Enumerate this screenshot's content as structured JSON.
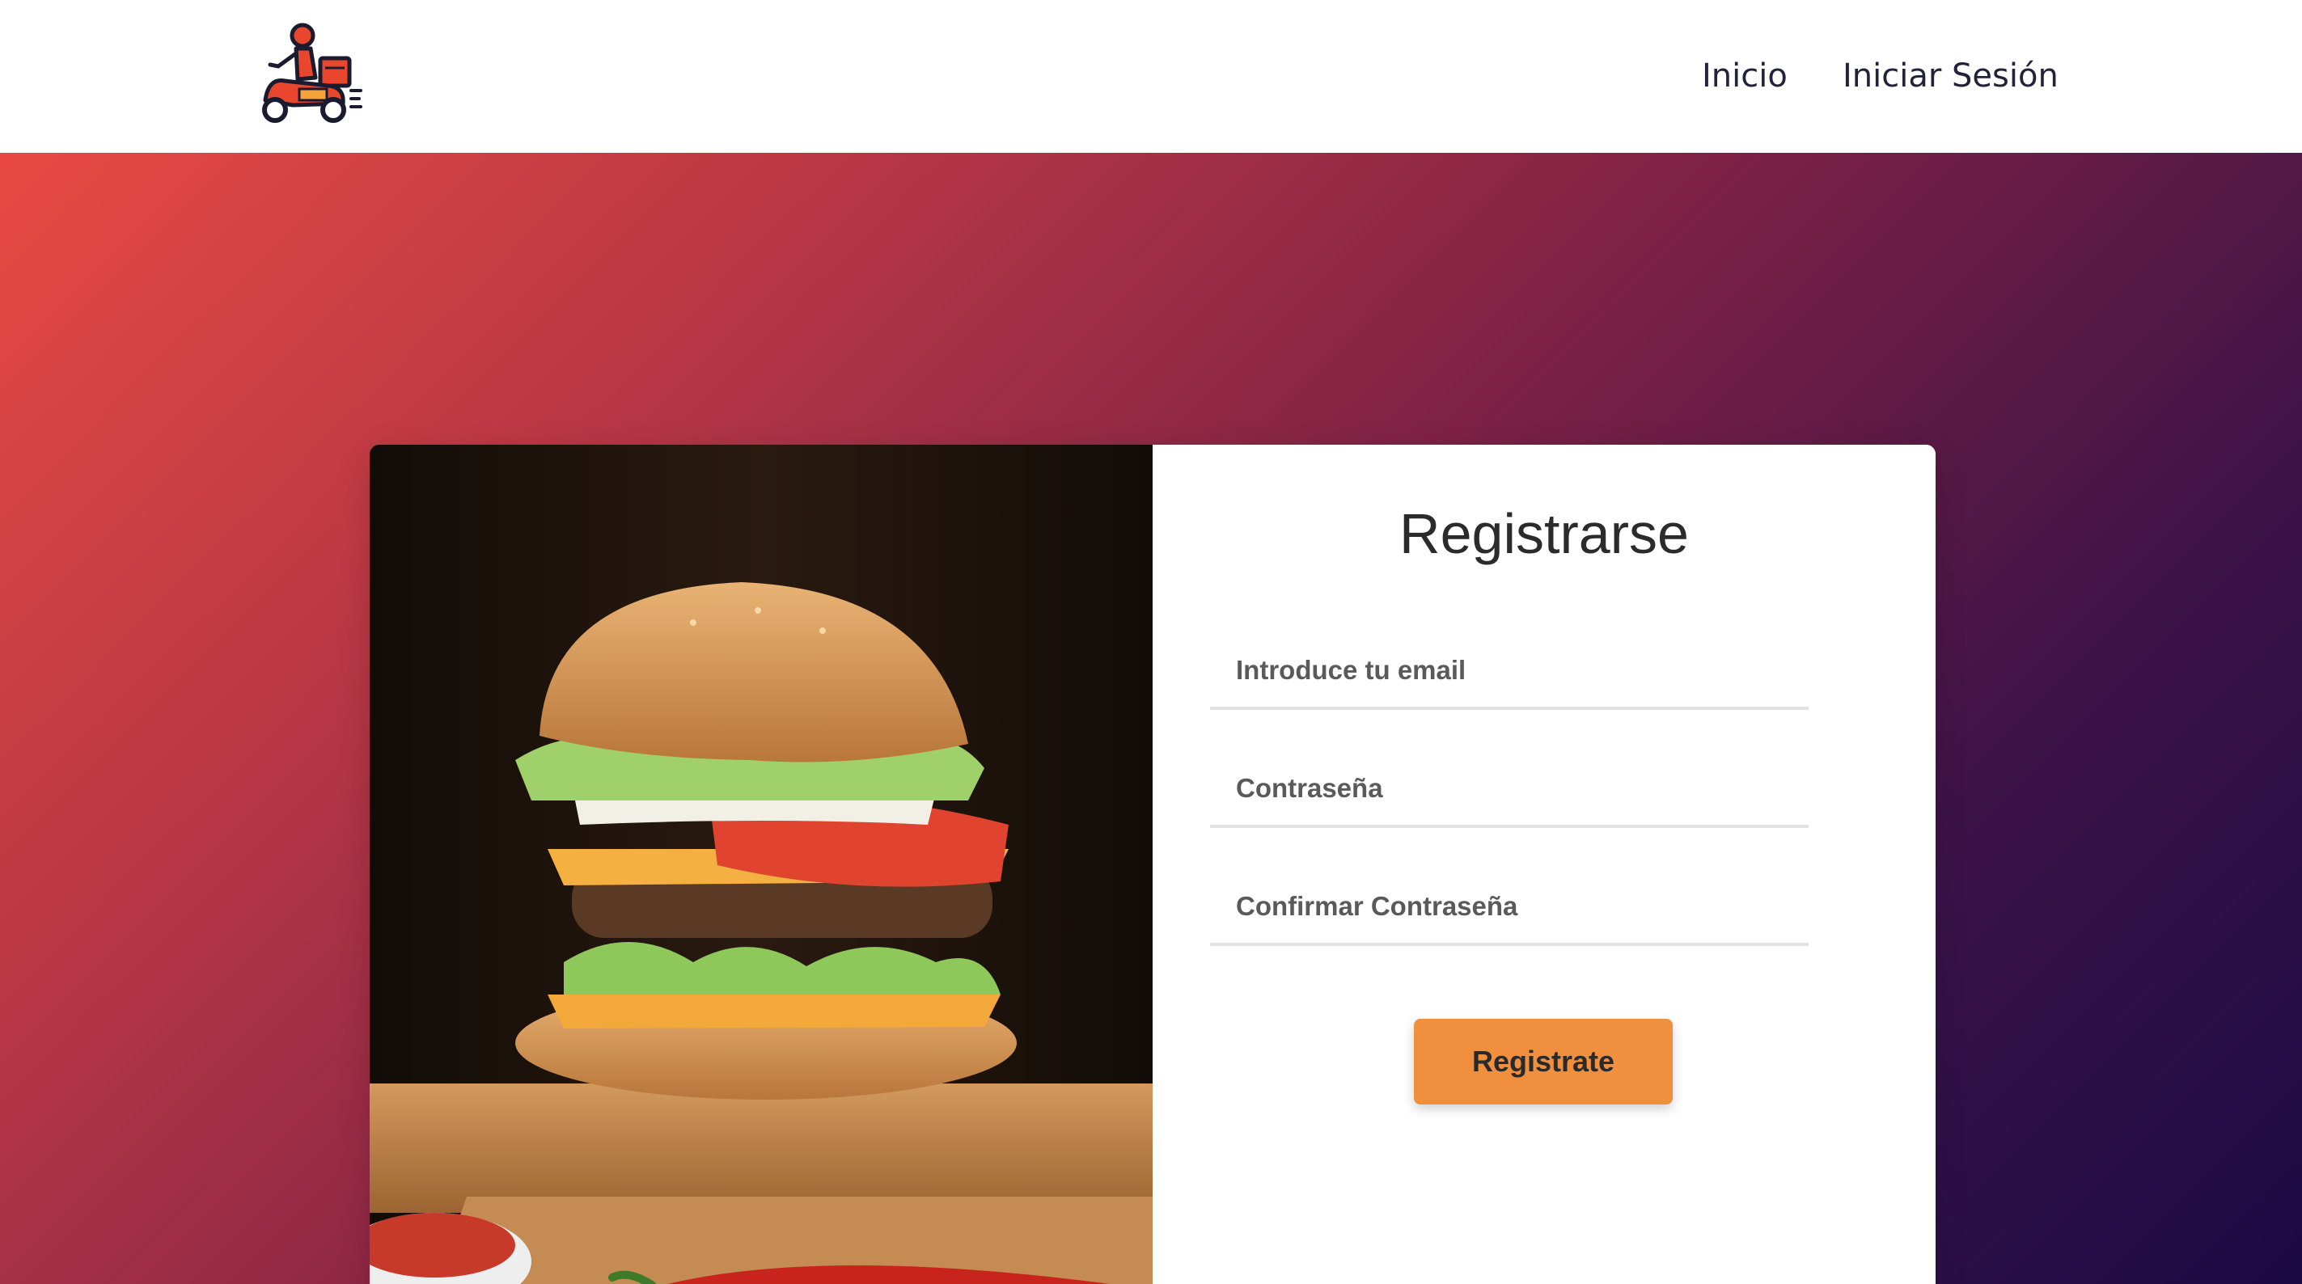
{
  "header": {
    "logo_icon": "delivery-scooter-icon",
    "nav": [
      {
        "label": "Inicio"
      },
      {
        "label": "Iniciar Sesión"
      }
    ]
  },
  "hero": {
    "gradient_colors": [
      "#e84a42",
      "#b23545",
      "#7a2045",
      "#3d1347",
      "#1b0a45"
    ]
  },
  "register_form": {
    "title": "Registrarse",
    "email_placeholder": "Introduce tu email",
    "password_placeholder": "Contraseña",
    "confirm_password_placeholder": "Confirmar Contraseña",
    "submit_label": "Registrate",
    "accent_color": "#f0903e"
  },
  "image": {
    "subject": "burger-photo"
  }
}
